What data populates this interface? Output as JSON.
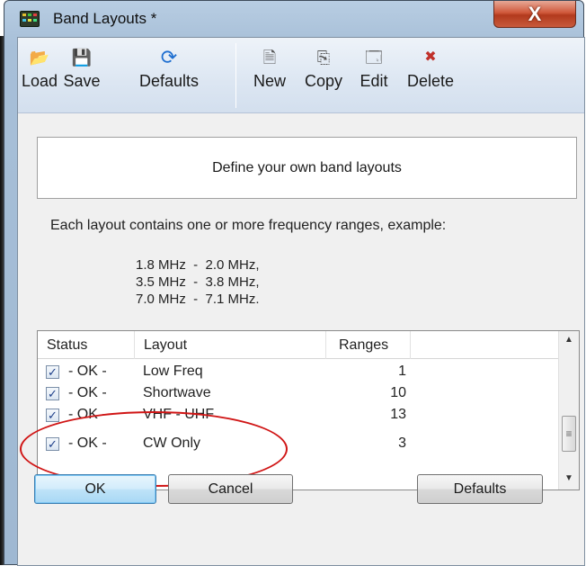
{
  "window": {
    "title": "Band Layouts *",
    "close_label": "X"
  },
  "toolbar": {
    "buttons": [
      {
        "label": "Load",
        "icon": "folder-open-icon",
        "glyph": "📂"
      },
      {
        "label": "Save",
        "icon": "floppy-disk-icon",
        "glyph": "💾"
      },
      {
        "label": "Defaults",
        "icon": "refresh-arrows-icon",
        "glyph": "⟳"
      },
      {
        "label": "New",
        "icon": "new-document-icon",
        "glyph": "🗎"
      },
      {
        "label": "Copy",
        "icon": "copy-icon",
        "glyph": "⎘"
      },
      {
        "label": "Edit",
        "icon": "properties-icon",
        "glyph": "🗔"
      },
      {
        "label": "Delete",
        "icon": "delete-x-icon",
        "glyph": "✖"
      }
    ]
  },
  "banner": {
    "text": "Define your own band layouts"
  },
  "info": {
    "text": "Each layout contains one or more frequency ranges, example:",
    "example_lines": [
      "1.8 MHz  -  2.0 MHz,",
      "3.5 MHz  -  3.8 MHz,",
      "7.0 MHz  -  7.1 MHz."
    ]
  },
  "list": {
    "columns": [
      "Status",
      "Layout",
      "Ranges"
    ],
    "rows": [
      {
        "checked": true,
        "status": "- OK -",
        "layout": "Low Freq",
        "ranges": "1"
      },
      {
        "checked": true,
        "status": "- OK -",
        "layout": "Shortwave",
        "ranges": "10"
      },
      {
        "checked": true,
        "status": "- OK -",
        "layout": "VHF - UHF",
        "ranges": "13"
      },
      {
        "checked": true,
        "status": "- OK -",
        "layout": "CW Only",
        "ranges": "3"
      }
    ],
    "check_glyph": "✓"
  },
  "buttons": {
    "ok": "OK",
    "cancel": "Cancel",
    "defaults": "Defaults"
  },
  "colors": {
    "highlight": "#d01515",
    "accent": "#3c7fb1"
  }
}
